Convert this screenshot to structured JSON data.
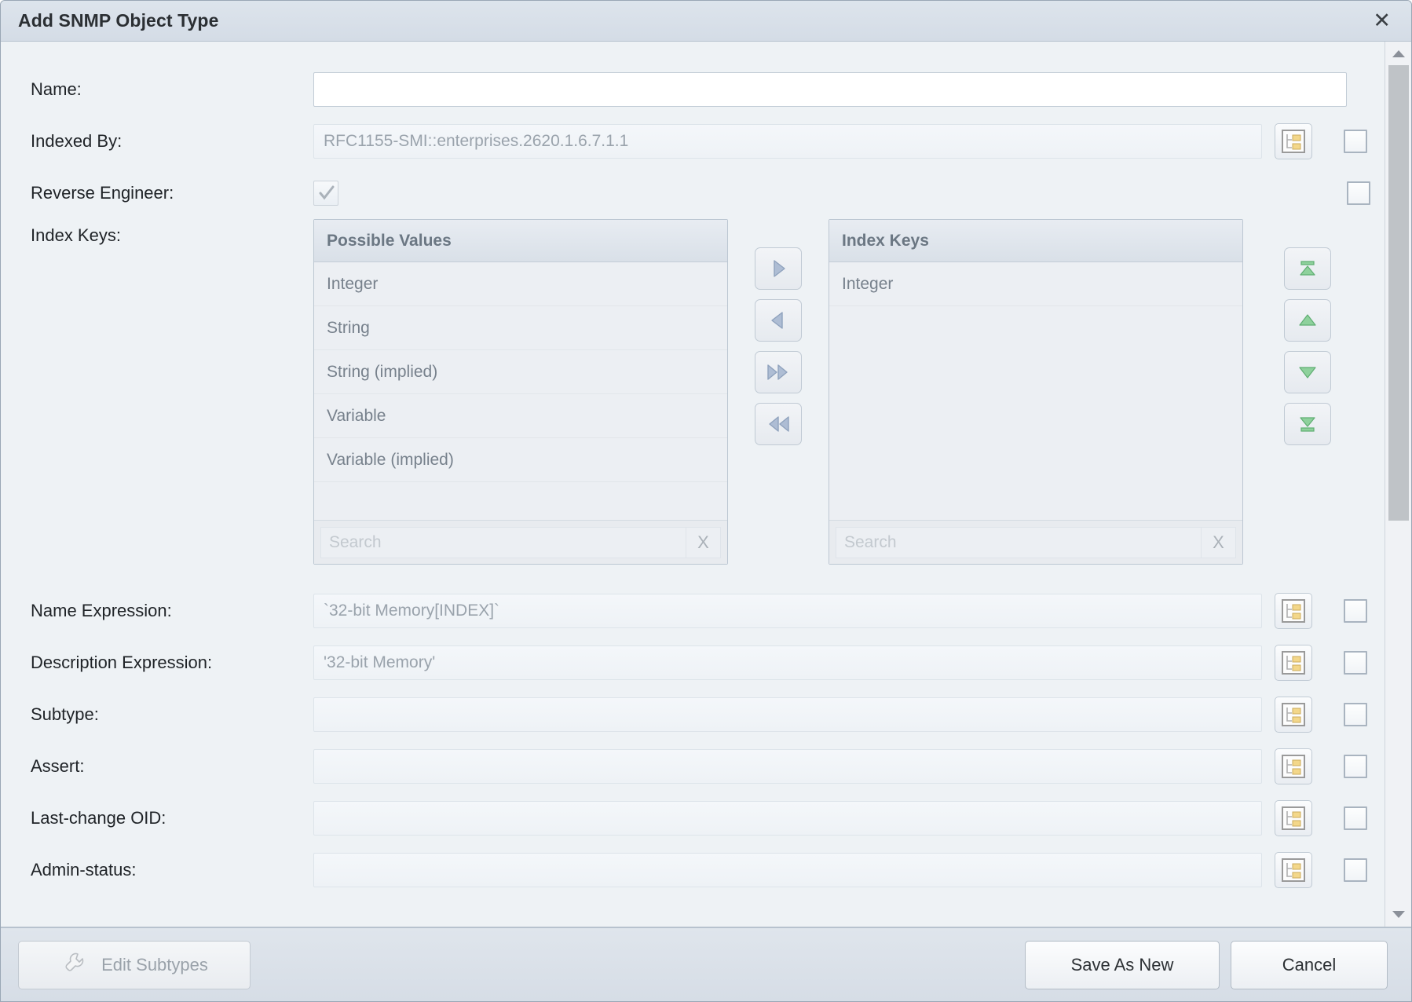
{
  "window": {
    "title": "Add SNMP Object Type",
    "close_label": "✕"
  },
  "form": {
    "name": {
      "label": "Name:",
      "value": "",
      "placeholder": ""
    },
    "indexed_by": {
      "label": "Indexed By:",
      "value": "RFC1155-SMI::enterprises.2620.1.6.7.1.1"
    },
    "reverse_engineer": {
      "label": "Reverse Engineer:",
      "checked": true
    },
    "index_keys": {
      "label": "Index Keys:"
    },
    "name_expression": {
      "label": "Name Expression:",
      "value": "`32-bit Memory[INDEX]`"
    },
    "description_expression": {
      "label": "Description Expression:",
      "value": "'32-bit Memory'"
    },
    "subtype": {
      "label": "Subtype:",
      "value": ""
    },
    "assert": {
      "label": "Assert:",
      "value": ""
    },
    "last_change_oid": {
      "label": "Last-change OID:",
      "value": ""
    },
    "admin_status": {
      "label": "Admin-status:",
      "value": ""
    }
  },
  "dual_list": {
    "possible": {
      "header": "Possible Values",
      "items": [
        "Integer",
        "String",
        "String (implied)",
        "Variable",
        "Variable (implied)"
      ],
      "search_placeholder": "Search",
      "clear_label": "X"
    },
    "selected": {
      "header": "Index Keys",
      "items": [
        "Integer"
      ],
      "search_placeholder": "Search",
      "clear_label": "X"
    },
    "transfer_buttons": [
      {
        "name": "move-right-icon"
      },
      {
        "name": "move-left-icon"
      },
      {
        "name": "move-all-right-icon"
      },
      {
        "name": "move-all-left-icon"
      }
    ],
    "order_buttons": [
      {
        "name": "move-to-top-icon"
      },
      {
        "name": "move-up-icon"
      },
      {
        "name": "move-down-icon"
      },
      {
        "name": "move-to-bottom-icon"
      }
    ]
  },
  "icons": {
    "browse": "tree-browse-icon",
    "wrench": "wrench-icon"
  },
  "footer": {
    "edit_subtypes": "Edit Subtypes",
    "save_as_new": "Save As New",
    "cancel": "Cancel"
  },
  "colors": {
    "accent_blue": "#9fb3cd",
    "accent_green": "#7ec98d",
    "titlebar": "#d9e0e8",
    "body_bg": "#eef2f5"
  }
}
